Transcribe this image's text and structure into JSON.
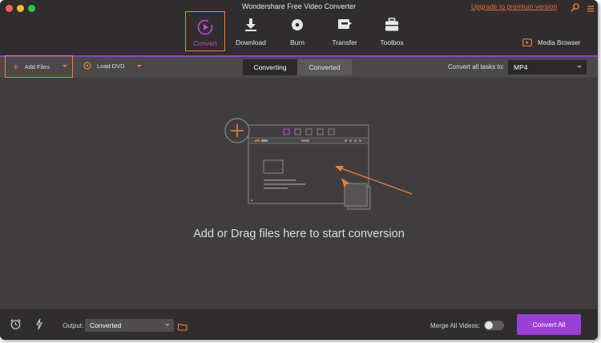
{
  "window": {
    "title": "Wondershare Free Video Converter",
    "upgrade_link": "Upgrade to premium version",
    "traffic_colors": [
      "#ff5f57",
      "#ffbd2e",
      "#28c940"
    ]
  },
  "nav": {
    "tabs": [
      {
        "label": "Convert",
        "icon": "play-circle-icon",
        "active": true
      },
      {
        "label": "Download",
        "icon": "download-icon",
        "active": false
      },
      {
        "label": "Burn",
        "icon": "disc-icon",
        "active": false
      },
      {
        "label": "Transfer",
        "icon": "transfer-icon",
        "active": false
      },
      {
        "label": "Toolbox",
        "icon": "toolbox-icon",
        "active": false
      }
    ],
    "media_browser": "Media Browser"
  },
  "toolbar": {
    "add_files": "Add Files",
    "load_dvd": "Load DVD",
    "segments": [
      "Converting",
      "Converted"
    ],
    "active_segment": "Converting",
    "convert_all_label": "Convert all tasks to:",
    "format": "MP4"
  },
  "dropzone": {
    "text": "Add or Drag files here to start conversion"
  },
  "bottom": {
    "output_label": "Output:",
    "output_value": "Converted",
    "merge_label": "Merge All Videos:",
    "merge_on": false,
    "convert_all_button": "Convert All"
  },
  "colors": {
    "accent_orange": "#f07f3a",
    "accent_purple": "#9a40d6",
    "background": "#3f3d3e",
    "topbar": "#2f2d2e"
  }
}
